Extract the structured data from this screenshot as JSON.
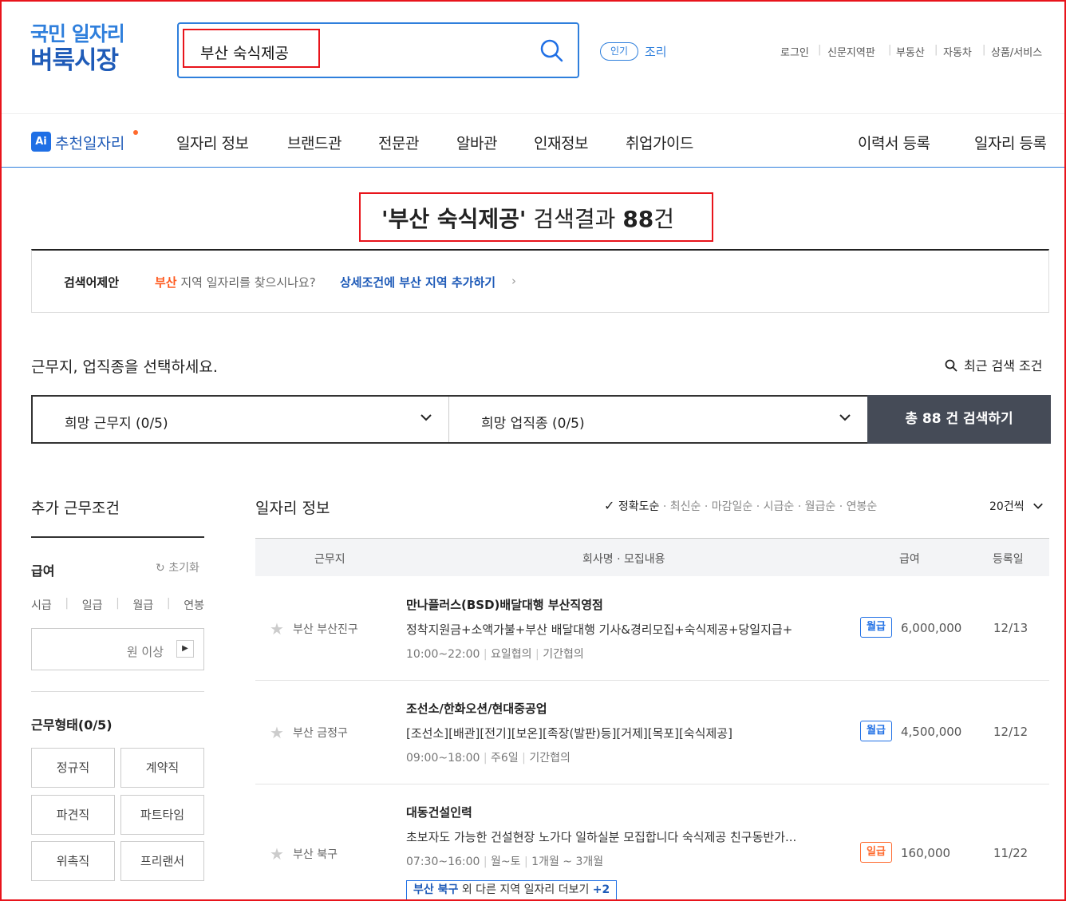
{
  "logo": {
    "line1": "국민 일자리",
    "line2": "벼룩시장"
  },
  "search": {
    "value": "부산 숙식제공"
  },
  "popular": {
    "badge": "인기",
    "keyword": "조리"
  },
  "utility_links": [
    "로그인",
    "신문지역판",
    "부동산",
    "자동차",
    "상품/서비스"
  ],
  "gnb": {
    "ai_badge": "Ai",
    "ai_label": "추천일자리",
    "items": [
      "일자리 정보",
      "브랜드관",
      "전문관",
      "알바관",
      "인재정보",
      "취업가이드"
    ],
    "right_items": [
      "이력서 등록",
      "일자리 등록"
    ]
  },
  "result": {
    "open_quote": "'",
    "keyword": "부산 숙식제공",
    "close_quote": "'",
    "suffix": " 검색결과 ",
    "count": "88",
    "unit": "건"
  },
  "suggest": {
    "label": "검색어제안",
    "region": "부산",
    "question": " 지역 일자리를 찾으시나요?",
    "link": "상세조건에 부산 지역 추가하기",
    "chevron": "›"
  },
  "selector": {
    "title": "근무지, 업직종을 선택하세요.",
    "recent": "최근 검색 조건",
    "location_label": "희망 근무지 (0/5)",
    "job_label": "희망 업직종 (0/5)",
    "search_button": "총 88 건 검색하기"
  },
  "sidebar": {
    "title": "추가 근무조건",
    "pay_title": "급여",
    "reset": "초기화",
    "pay_types": [
      "시급",
      "일급",
      "월급",
      "연봉"
    ],
    "amount_placeholder": "원 이상",
    "amount_button": "▶",
    "worktype_title": "근무형태(0/5)",
    "worktypes": [
      "정규직",
      "계약직",
      "파견직",
      "파트타임",
      "위촉직",
      "프리랜서"
    ]
  },
  "jobs": {
    "title": "일자리 정보",
    "sort_active": "정확도순",
    "sort_options": [
      "최신순",
      "마감일순",
      "시급순",
      "월급순",
      "연봉순"
    ],
    "per_page": "20건씩",
    "columns": [
      "근무지",
      "회사명 · 모집내용",
      "급여",
      "등록일"
    ],
    "rows": [
      {
        "location": "부산 부산진구",
        "company": "만나플러스(BSD)배달대행 부산직영점",
        "desc": "정착지원금+소액가불+부산 배달대행 기사&경리모집+숙식제공+당일지급+",
        "time": "10:00~22:00",
        "days": "요일협의",
        "period": "기간협의",
        "pay_type": "월급",
        "pay": "6,000,000",
        "date": "12/13"
      },
      {
        "location": "부산 금정구",
        "company": "조선소/한화오션/현대중공업",
        "desc": "[조선소][배관][전기][보온][족장(발판)등][거제][목포][숙식제공]",
        "time": "09:00~18:00",
        "days": "주6일",
        "period": "기간협의",
        "pay_type": "월급",
        "pay": "4,500,000",
        "date": "12/12"
      },
      {
        "location": "부산 북구",
        "company": "대동건설인력",
        "desc": "초보자도 가능한 건설현장 노가다 일하실분 모집합니다 숙식제공 친구동반가...",
        "time": "07:30~16:00",
        "days": "월~토",
        "period": "1개월 ~ 3개월",
        "pay_type": "일급",
        "pay": "160,000",
        "date": "11/22",
        "more_region": "부산 북구",
        "more_text": " 외 다른 지역 일자리 더보기 ",
        "more_count": "+2"
      }
    ]
  },
  "colors": {
    "brand_blue": "#1f6fe5",
    "highlight_red": "#e8141b",
    "orange": "#ff6a2d",
    "dark_button": "#454b57"
  }
}
